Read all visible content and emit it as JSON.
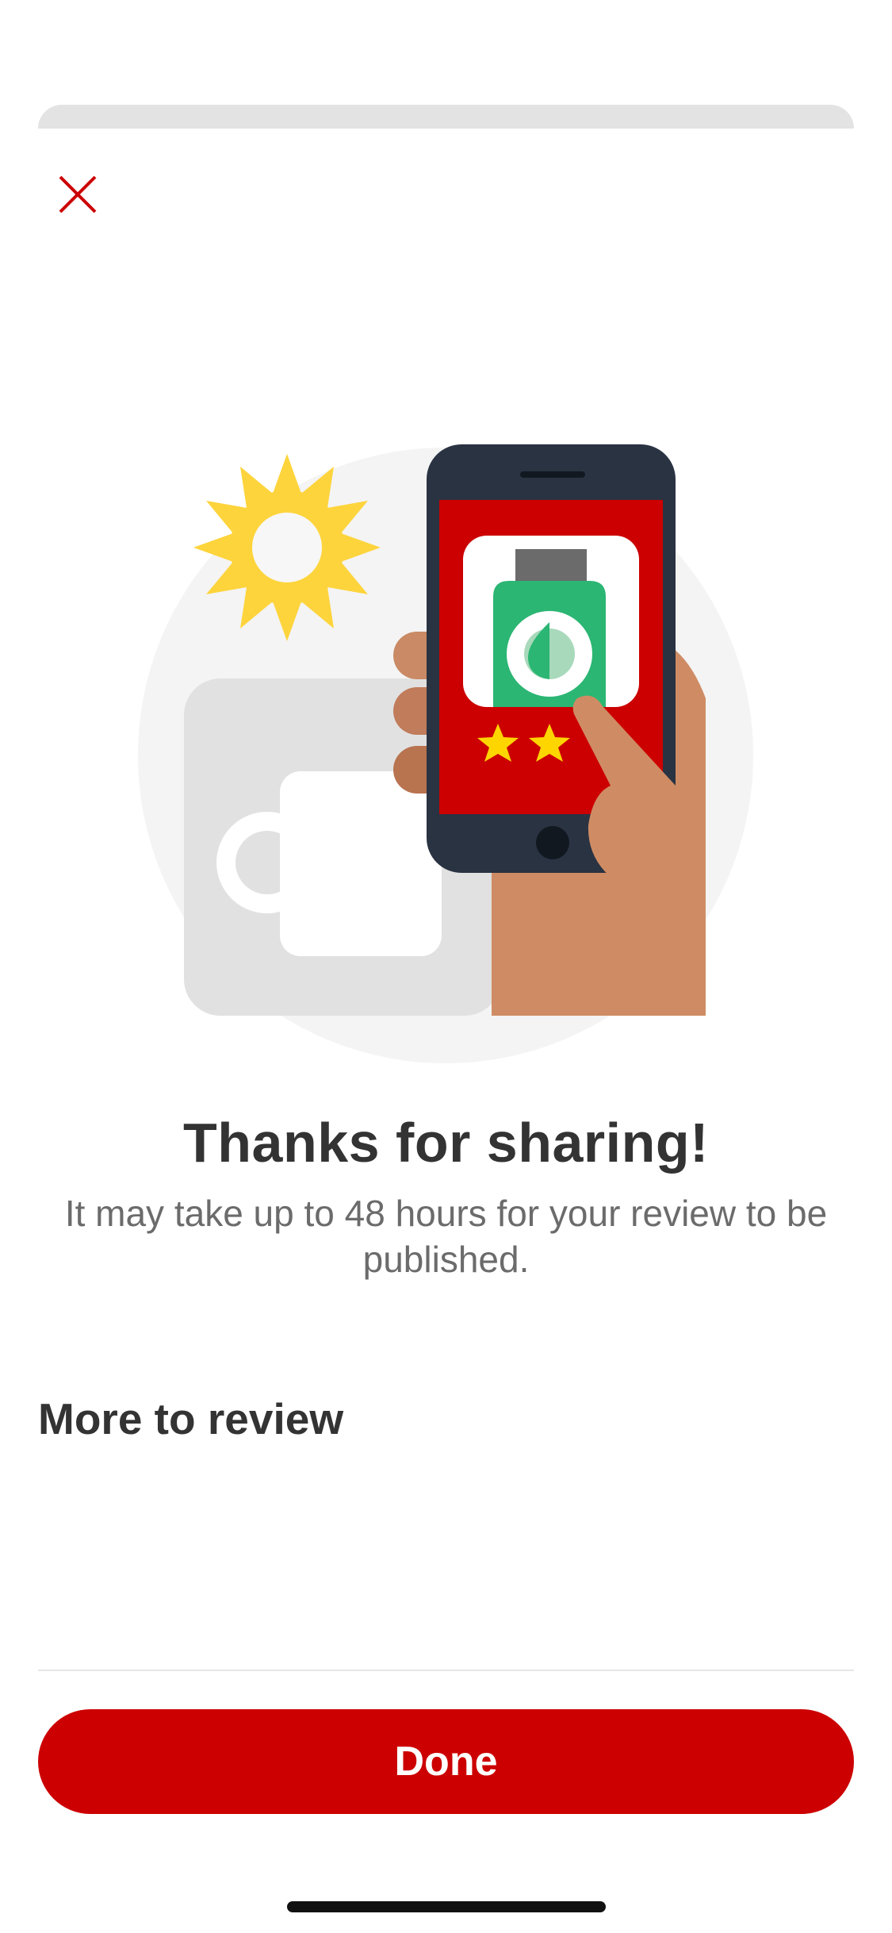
{
  "header": {
    "close_icon": "close-icon"
  },
  "illustration": {
    "icons": [
      "sun-icon",
      "mug-icon",
      "hand-icon",
      "phone-icon",
      "bottle-icon",
      "star-icon"
    ],
    "colors": {
      "brand_red": "#cc0000",
      "sun": "#fdd43c",
      "bottle": "#2bb673",
      "phone_body": "#2a3342",
      "skin": "#cf8c64"
    }
  },
  "confirmation": {
    "title": "Thanks for sharing!",
    "subtitle": "It may take up to 48 hours for your review to be published."
  },
  "more_to_review": {
    "title": "More to review"
  },
  "footer": {
    "done_label": "Done"
  },
  "colors": {
    "accent": "#cc0000",
    "text_primary": "#333333",
    "text_secondary": "#6b6b6b"
  }
}
